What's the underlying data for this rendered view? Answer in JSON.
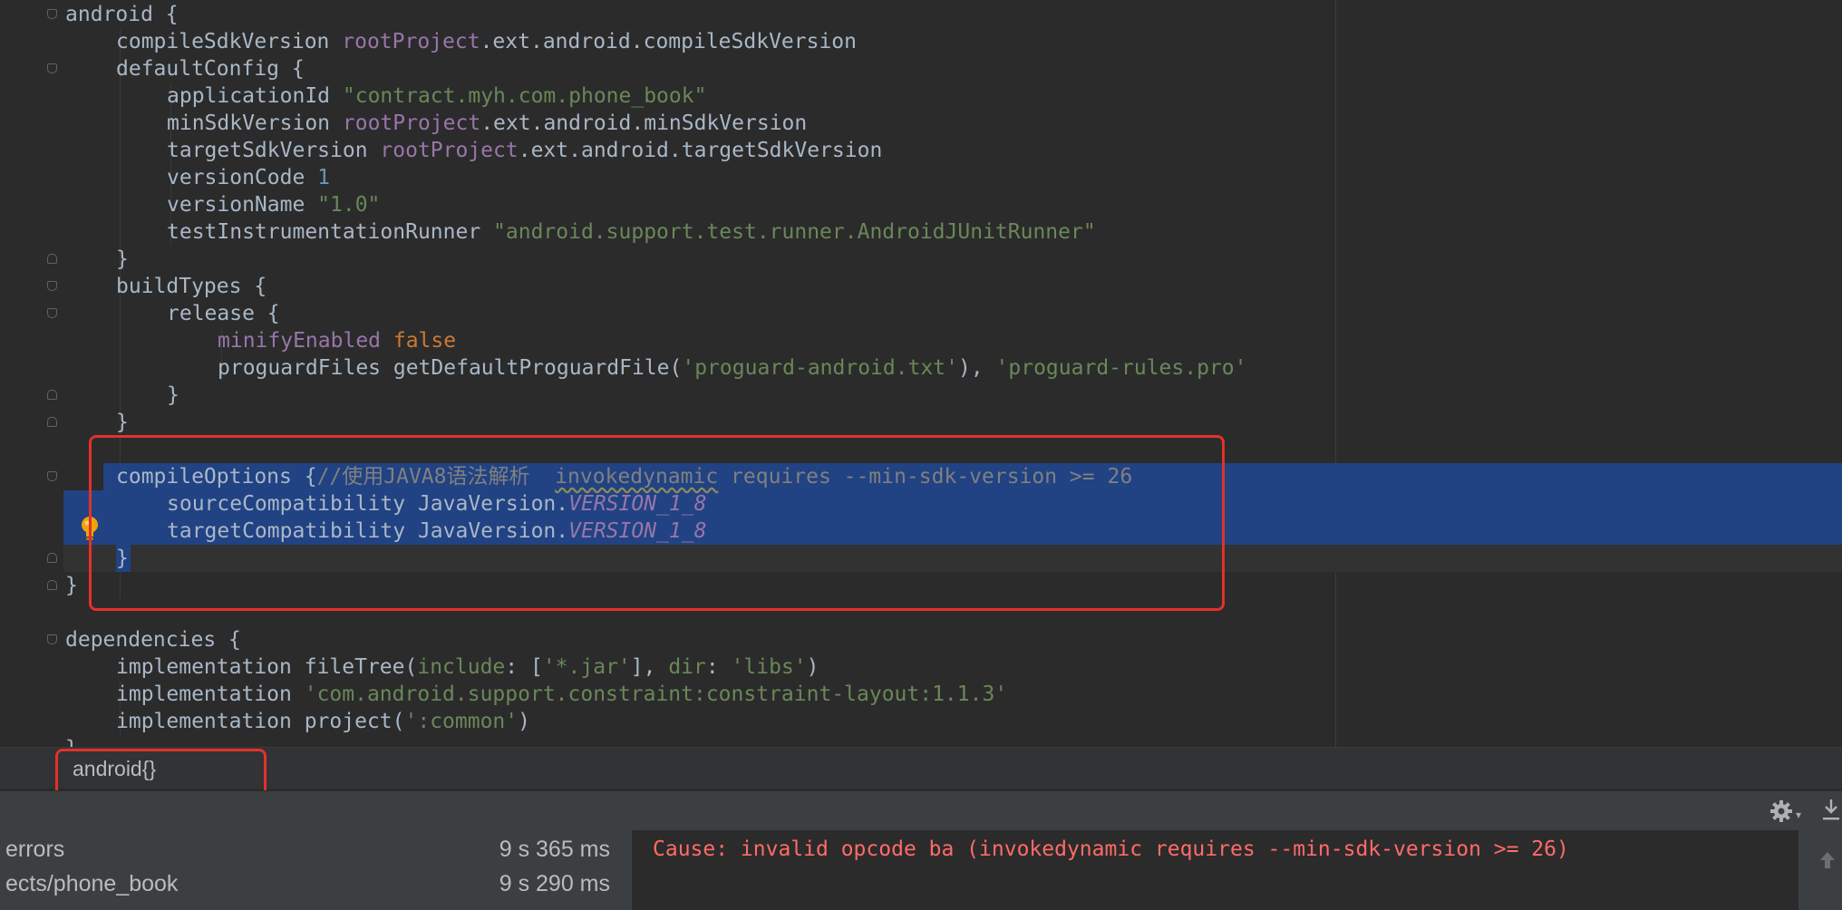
{
  "editor": {
    "lines": [
      {
        "indent": 0,
        "segs": [
          {
            "t": "android {",
            "c": "plain"
          }
        ]
      },
      {
        "indent": 1,
        "segs": [
          {
            "t": "compileSdkVersion ",
            "c": "plain"
          },
          {
            "t": "rootProject",
            "c": "purple"
          },
          {
            "t": ".ext.android.compileSdkVersion",
            "c": "plain"
          }
        ]
      },
      {
        "indent": 1,
        "segs": [
          {
            "t": "defaultConfig {",
            "c": "plain"
          }
        ]
      },
      {
        "indent": 2,
        "segs": [
          {
            "t": "applicationId ",
            "c": "plain"
          },
          {
            "t": "\"contract.myh.com.phone_book\"",
            "c": "str"
          }
        ]
      },
      {
        "indent": 2,
        "segs": [
          {
            "t": "minSdkVersion ",
            "c": "plain"
          },
          {
            "t": "rootProject",
            "c": "purple"
          },
          {
            "t": ".ext.android.minSdkVersion",
            "c": "plain"
          }
        ]
      },
      {
        "indent": 2,
        "segs": [
          {
            "t": "targetSdkVersion ",
            "c": "plain"
          },
          {
            "t": "rootProject",
            "c": "purple"
          },
          {
            "t": ".ext.android.targetSdkVersion",
            "c": "plain"
          }
        ]
      },
      {
        "indent": 2,
        "segs": [
          {
            "t": "versionCode ",
            "c": "plain"
          },
          {
            "t": "1",
            "c": "num"
          }
        ]
      },
      {
        "indent": 2,
        "segs": [
          {
            "t": "versionName ",
            "c": "plain"
          },
          {
            "t": "\"1.0\"",
            "c": "str"
          }
        ]
      },
      {
        "indent": 2,
        "segs": [
          {
            "t": "testInstrumentationRunner ",
            "c": "plain"
          },
          {
            "t": "\"android.support.test.runner.AndroidJUnitRunner\"",
            "c": "str"
          }
        ]
      },
      {
        "indent": 1,
        "segs": [
          {
            "t": "}",
            "c": "plain"
          }
        ]
      },
      {
        "indent": 1,
        "segs": [
          {
            "t": "buildTypes {",
            "c": "plain"
          }
        ]
      },
      {
        "indent": 2,
        "segs": [
          {
            "t": "release {",
            "c": "plain"
          }
        ]
      },
      {
        "indent": 3,
        "segs": [
          {
            "t": "minifyEnabled ",
            "c": "purple"
          },
          {
            "t": "false",
            "c": "kw"
          }
        ]
      },
      {
        "indent": 3,
        "segs": [
          {
            "t": "proguardFiles getDefaultProguardFile(",
            "c": "plain"
          },
          {
            "t": "'proguard-android.txt'",
            "c": "str"
          },
          {
            "t": "), ",
            "c": "plain"
          },
          {
            "t": "'proguard-rules.pro'",
            "c": "str"
          }
        ]
      },
      {
        "indent": 2,
        "segs": [
          {
            "t": "}",
            "c": "plain"
          }
        ]
      },
      {
        "indent": 1,
        "segs": [
          {
            "t": "}",
            "c": "plain"
          }
        ]
      },
      {
        "indent": 0,
        "segs": []
      },
      {
        "indent": 1,
        "segs": [
          {
            "t": "compileOptions {",
            "c": "plain"
          },
          {
            "t": "//使用JAVA8语法解析  ",
            "c": "cmt"
          },
          {
            "t": "invokedynamic",
            "c": "cmtwarn"
          },
          {
            "t": " requires --min-sdk-version >= 26",
            "c": "cmt"
          }
        ]
      },
      {
        "indent": 2,
        "segs": [
          {
            "t": "sourceCompatibility JavaVersion.",
            "c": "plain"
          },
          {
            "t": "VERSION_1_8",
            "c": "static"
          }
        ]
      },
      {
        "indent": 2,
        "segs": [
          {
            "t": "targetCompatibility JavaVersion.",
            "c": "plain"
          },
          {
            "t": "VERSION_1_8",
            "c": "static"
          }
        ]
      },
      {
        "indent": 1,
        "segs": [
          {
            "t": "}",
            "c": "plain"
          }
        ]
      },
      {
        "indent": 0,
        "segs": [
          {
            "t": "}",
            "c": "plain"
          }
        ]
      },
      {
        "indent": 0,
        "segs": []
      },
      {
        "indent": 0,
        "segs": [
          {
            "t": "dependencies {",
            "c": "plain"
          }
        ]
      },
      {
        "indent": 1,
        "segs": [
          {
            "t": "implementation fileTree(",
            "c": "plain"
          },
          {
            "t": "include",
            "c": "str"
          },
          {
            "t": ": [",
            "c": "plain"
          },
          {
            "t": "'*.jar'",
            "c": "str"
          },
          {
            "t": "], ",
            "c": "plain"
          },
          {
            "t": "dir",
            "c": "str"
          },
          {
            "t": ": ",
            "c": "plain"
          },
          {
            "t": "'libs'",
            "c": "str"
          },
          {
            "t": ")",
            "c": "plain"
          }
        ]
      },
      {
        "indent": 1,
        "segs": [
          {
            "t": "implementation ",
            "c": "plain"
          },
          {
            "t": "'com.android.support.constraint:constraint-layout:1.1.3'",
            "c": "str"
          }
        ]
      },
      {
        "indent": 1,
        "segs": [
          {
            "t": "implementation project(",
            "c": "plain"
          },
          {
            "t": "':common'",
            "c": "str"
          },
          {
            "t": ")",
            "c": "plain"
          }
        ]
      },
      {
        "indent": 0,
        "segs": [
          {
            "t": "}",
            "c": "plain"
          }
        ]
      }
    ]
  },
  "breadcrumb": {
    "label": "android{}"
  },
  "build_tree": {
    "rows": [
      {
        "name": "errors",
        "time": "9 s 365 ms"
      },
      {
        "name": "ects/phone_book",
        "time": "9 s 290 ms"
      }
    ]
  },
  "console": {
    "message": "Cause: invalid opcode ba (invokedynamic requires --min-sdk-version >= 26)"
  },
  "icons": {
    "bulb": "intention-bulb-icon",
    "gear": "gear-icon",
    "download": "download-icon",
    "scroll_up": "arrow-up-icon"
  },
  "colors": {
    "editor_bg": "#2b2b2b",
    "selection": "#214283",
    "highlight_box": "#e2312b",
    "error_text": "#ff6b68"
  }
}
